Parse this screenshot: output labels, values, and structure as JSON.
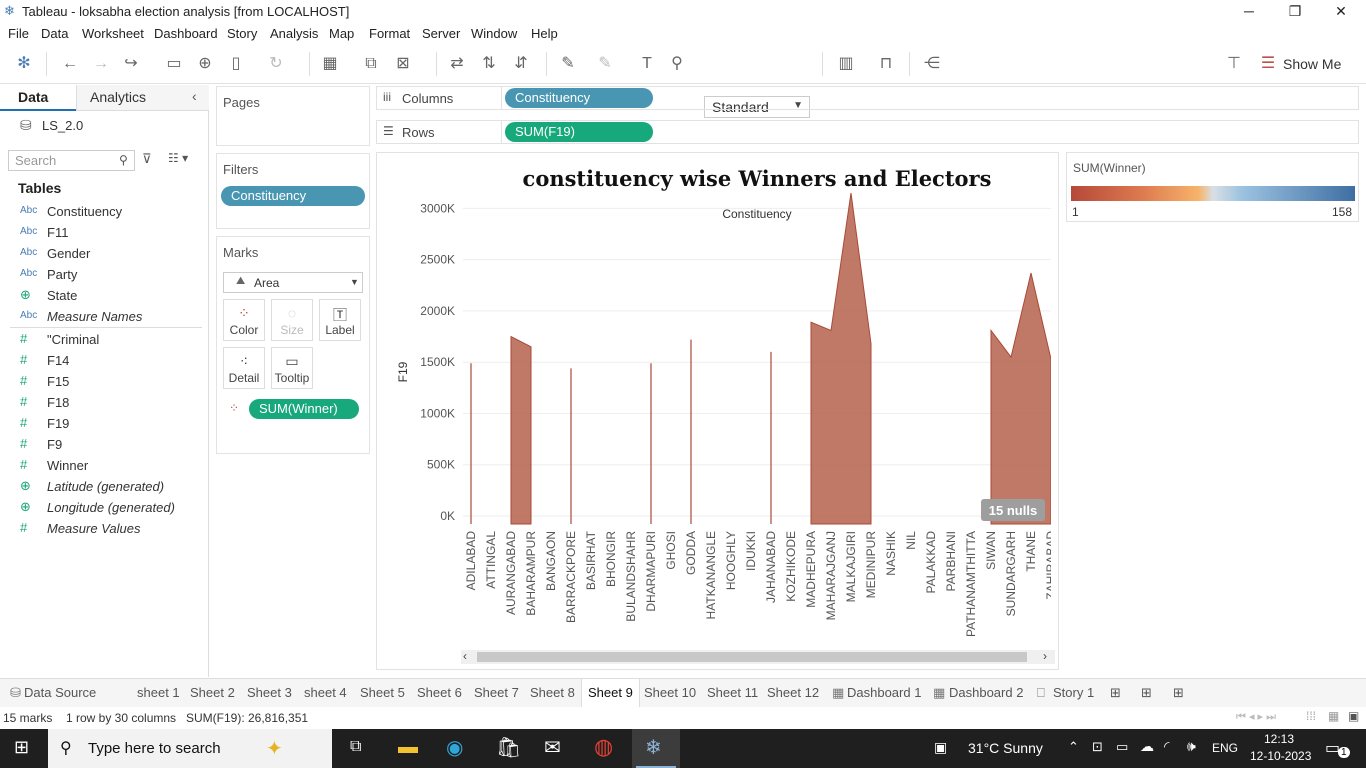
{
  "window": {
    "title": "Tableau - loksabha election analysis [from LOCALHOST]",
    "minimize": "─",
    "restore": "❐",
    "close": "✕"
  },
  "menu": [
    "File",
    "Data",
    "Worksheet",
    "Dashboard",
    "Story",
    "Analysis",
    "Map",
    "Format",
    "Server",
    "Window",
    "Help"
  ],
  "toolbar": {
    "fit_select": "Standard",
    "show_me": "Show Me"
  },
  "left_pane": {
    "tabs": {
      "data": "Data",
      "analytics": "Analytics"
    },
    "datasource": "LS_2.0",
    "search_placeholder": "Search",
    "tables_heading": "Tables",
    "fields": [
      {
        "type": "Abc",
        "name": "Constituency",
        "italic": false
      },
      {
        "type": "Abc",
        "name": "F11",
        "italic": false
      },
      {
        "type": "Abc",
        "name": "Gender",
        "italic": false
      },
      {
        "type": "Abc",
        "name": "Party",
        "italic": false
      },
      {
        "type": "geo",
        "name": "State",
        "italic": false
      },
      {
        "type": "Abc",
        "name": "Measure Names",
        "italic": true
      },
      {
        "type": "#",
        "name": "\"Criminal",
        "italic": false
      },
      {
        "type": "#",
        "name": "F14",
        "italic": false
      },
      {
        "type": "#",
        "name": "F15",
        "italic": false
      },
      {
        "type": "#",
        "name": "F18",
        "italic": false
      },
      {
        "type": "#",
        "name": "F19",
        "italic": false
      },
      {
        "type": "#",
        "name": "F9",
        "italic": false
      },
      {
        "type": "#",
        "name": "Winner",
        "italic": false
      },
      {
        "type": "geo",
        "name": "Latitude (generated)",
        "italic": true
      },
      {
        "type": "geo",
        "name": "Longitude (generated)",
        "italic": true
      },
      {
        "type": "#",
        "name": "Measure Values",
        "italic": true
      }
    ]
  },
  "pages": {
    "title": "Pages"
  },
  "filters": {
    "title": "Filters",
    "pill": "Constituency"
  },
  "marks": {
    "title": "Marks",
    "type": "Area",
    "buttons": [
      "Color",
      "Size",
      "Label",
      "Detail",
      "Tooltip"
    ],
    "color_pill": "SUM(Winner)"
  },
  "shelves": {
    "columns_label": "Columns",
    "columns_pill": "Constituency",
    "rows_label": "Rows",
    "rows_pill": "SUM(F19)"
  },
  "legend": {
    "title": "SUM(Winner)",
    "min": "1",
    "max": "158"
  },
  "viz": {
    "title": "constituency wise Winners and Electors",
    "header": "Constituency",
    "nulls": "15 nulls"
  },
  "chart_data": {
    "type": "area",
    "title": "constituency wise Winners and Electors",
    "xlabel": "Constituency",
    "ylabel": "F19",
    "ylim": [
      0,
      3150000
    ],
    "y_ticks": [
      "0K",
      "500K",
      "1000K",
      "1500K",
      "2000K",
      "2500K",
      "3000K"
    ],
    "y_tick_values": [
      0,
      500000,
      1000000,
      1500000,
      2000000,
      2500000,
      3000000
    ],
    "categories": [
      "ADILABAD",
      "ATTINGAL",
      "AURANGABAD",
      "BAHARAMPUR",
      "BANGAON",
      "BARRACKPORE",
      "BASIRHAT",
      "BHONGIR",
      "BULANDSHAHR",
      "DHARMAPURI",
      "GHOSI",
      "GODDA",
      "HATKANANGLE",
      "HOOGHLY",
      "IDUKKI",
      "JAHANABAD",
      "KOZHIKODE",
      "MADHEPURA",
      "MAHARAJGANJ",
      "MALKAJGIRI",
      "MEDINIPUR",
      "NASHIK",
      "NIL",
      "PALAKKAD",
      "PARBHANI",
      "PATHANAMTHITTA",
      "SIWAN",
      "SUNDARGARH",
      "THANE",
      "ZAHIRABAD"
    ],
    "values": [
      1490000,
      null,
      1750000,
      1650000,
      null,
      1440000,
      null,
      null,
      null,
      1490000,
      null,
      1720000,
      null,
      null,
      null,
      1600000,
      null,
      1890000,
      1810000,
      3150000,
      1680000,
      null,
      null,
      null,
      null,
      null,
      1810000,
      1550000,
      2370000,
      1530000
    ],
    "color": "#b5614c",
    "grid": "horizontal"
  },
  "sheet_tabs": [
    "Data Source",
    "sheet 1",
    "Sheet 2",
    "Sheet 3",
    "sheet 4",
    "Sheet 5",
    "Sheet 6",
    "Sheet 7",
    "Sheet 8",
    "Sheet 9",
    "Sheet 10",
    "Sheet 11",
    "Sheet 12",
    "Dashboard 1",
    "Dashboard 2",
    "Story 1"
  ],
  "active_tab": "Sheet 9",
  "status": {
    "marks": "15 marks",
    "rows_cols": "1 row by 30 columns",
    "sum": "SUM(F19): 26,816,351"
  },
  "taskbar": {
    "search": "Type here to search",
    "weather": "31°C  Sunny",
    "lang": "ENG",
    "time": "12:13",
    "date": "12-10-2023",
    "notif": "1"
  }
}
